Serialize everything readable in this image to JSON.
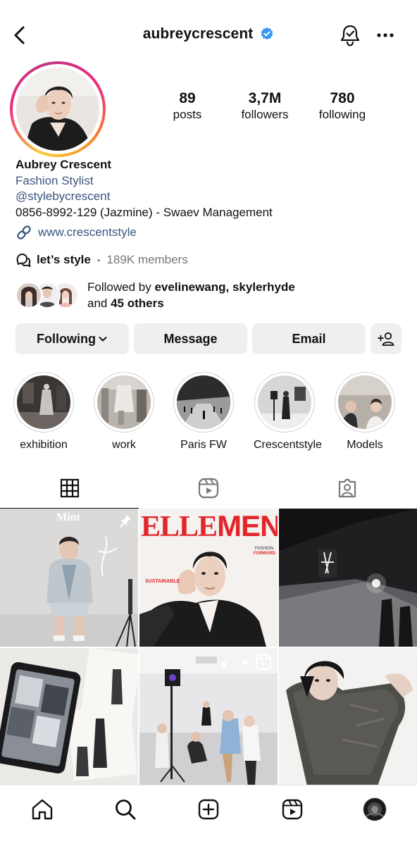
{
  "header": {
    "username": "aubreycrescent",
    "back_icon": "chevron-left-icon",
    "bell_icon": "bell-icon",
    "more_icon": "more-horizontal-icon"
  },
  "stats": {
    "posts": {
      "count": "89",
      "label": "posts"
    },
    "followers": {
      "count": "3,7M",
      "label": "followers"
    },
    "following": {
      "count": "780",
      "label": "following"
    }
  },
  "bio": {
    "name": "Aubrey Crescent",
    "category": "Fashion Stylist",
    "handle": "@stylebycrescent",
    "contact": "0856-8992-129 (Jazmine) - Swaev Management",
    "link": "www.crescentstyle"
  },
  "channel": {
    "name": "let’s style",
    "members": "189K members"
  },
  "followed_by": {
    "prefix": "Followed by ",
    "names": "evelinewang, skylerhyde",
    "and": "and ",
    "others": "45 others"
  },
  "buttons": {
    "following": "Following",
    "message": "Message",
    "email": "Email"
  },
  "highlights": [
    {
      "label": "exhibition"
    },
    {
      "label": "work"
    },
    {
      "label": "Paris FW"
    },
    {
      "label": "Crescentstyle"
    },
    {
      "label": "Models"
    }
  ],
  "grid": {
    "post1_text": "Mint",
    "post2_logo_elle": "ELLE",
    "post2_logo_men": "MEN",
    "post2_badge_line1": "FASHION",
    "post2_badge_line2": "FORWARD",
    "post2_badge_line3": "SUSTAINABLE"
  },
  "colors": {
    "link": "#3a5580",
    "button_bg": "#efefef",
    "verified": "#3897f0"
  }
}
